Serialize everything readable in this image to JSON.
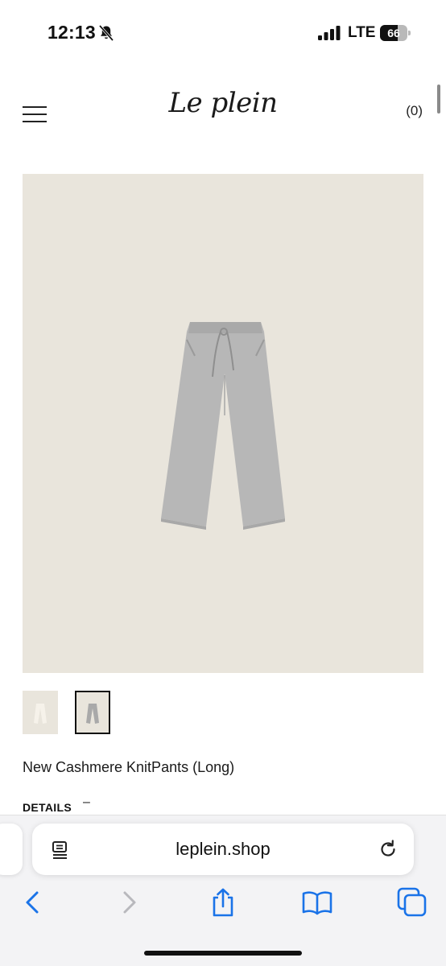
{
  "status_bar": {
    "time": "12:13",
    "network": "LTE",
    "battery_level": "66",
    "battery_percent": 66,
    "icons": [
      "bell-slash-icon",
      "signal-icon",
      "battery-icon"
    ]
  },
  "header": {
    "logo": "Le plein",
    "cart_count": "(0)",
    "icons": [
      "hamburger-menu-icon"
    ]
  },
  "product": {
    "title": "New Cashmere KnitPants (Long)",
    "details_label": "DETAILS",
    "details_toggle": "–",
    "image_background": "#e9e5dc",
    "garment_color": "#b7b7b7",
    "thumbnails": [
      {
        "selected": false,
        "variant": "cream"
      },
      {
        "selected": true,
        "variant": "grey"
      }
    ]
  },
  "browser": {
    "url": "leplein.shop",
    "accent_color": "#1a73e8",
    "icons": [
      "reader-icon",
      "reload-icon",
      "back-icon",
      "forward-icon",
      "share-icon",
      "bookmarks-icon",
      "tabs-icon"
    ]
  }
}
